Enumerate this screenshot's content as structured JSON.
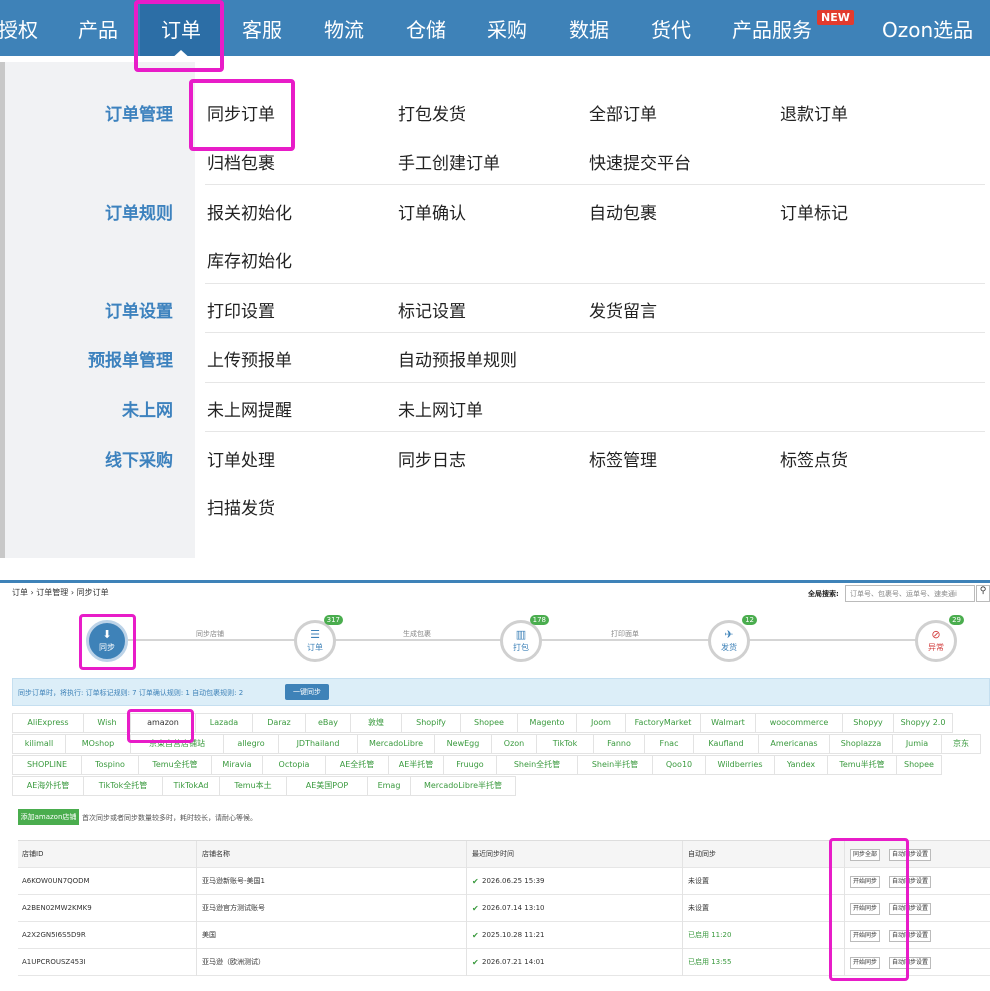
{
  "topnav": {
    "items": [
      "授权",
      "产品",
      "订单",
      "客服",
      "物流",
      "仓储",
      "采购",
      "数据",
      "货代",
      "产品服务",
      "Ozon选品"
    ],
    "new_badge": "NEW"
  },
  "menu": {
    "categories": {
      "order_mgmt": "订单管理",
      "order_rules": "订单规则",
      "order_settings": "订单设置",
      "prereport": "预报单管理",
      "offline": "未上网",
      "offline_purchase": "线下采购"
    },
    "order_mgmt": [
      "同步订单",
      "打包发货",
      "全部订单",
      "退款订单",
      "归档包裹",
      "手工创建订单",
      "快速提交平台"
    ],
    "order_rules": [
      "报关初始化",
      "订单确认",
      "自动包裹",
      "订单标记",
      "库存初始化"
    ],
    "order_settings": [
      "打印设置",
      "标记设置",
      "发货留言"
    ],
    "prereport": [
      "上传预报单",
      "自动预报单规则"
    ],
    "offline": [
      "未上网提醒",
      "未上网订单"
    ],
    "offline_purchase": [
      "订单处理",
      "同步日志",
      "标签管理",
      "标签点货",
      "扫描发货"
    ]
  },
  "bottom": {
    "breadcrumb": "订单 › 订单管理 › 同步订单",
    "global_search_label": "全局搜索:",
    "global_search_placeholder": "订单号、包裹号、运单号、速卖通i",
    "flow_labels": [
      "同步店铺",
      "生成包裹",
      "打印面单"
    ],
    "steps": [
      {
        "icon": "⬇",
        "label": "同步",
        "count": ""
      },
      {
        "icon": "☰",
        "label": "订单",
        "count": "317"
      },
      {
        "icon": "▥",
        "label": "打包",
        "count": "178"
      },
      {
        "icon": "✈",
        "label": "发货",
        "count": "12"
      },
      {
        "icon": "⊘",
        "label": "异常",
        "count": "29"
      }
    ],
    "info": "同步订单时，将执行: 订单标记规则: 7   订单确认规则: 1   自动包裹规则: 2",
    "one_click_sync": "一键同步",
    "platform_rows": [
      [
        "AliExpress",
        "Wish",
        "amazon",
        "Lazada",
        "Daraz",
        "eBay",
        "敦煌",
        "Shopify",
        "Shopee",
        "Magento",
        "Joom",
        "FactoryMarket",
        "Walmart",
        "woocommerce",
        "Shopyy",
        "Shopyy 2.0"
      ],
      [
        "kilimall",
        "MOshop",
        "京東自营店铺站",
        "allegro",
        "JDThailand",
        "MercadoLibre",
        "NewEgg",
        "Ozon",
        "TikTok",
        "Fanno",
        "Fnac",
        "Kaufland",
        "Americanas",
        "Shoplazza",
        "Jumia",
        "京东"
      ],
      [
        "SHOPLINE",
        "Tospino",
        "Temu全托管",
        "Miravia",
        "Octopia",
        "AE全托管",
        "AE半托管",
        "Fruugo",
        "Shein全托管",
        "Shein半托管",
        "Qoo10",
        "Wildberries",
        "Yandex",
        "Temu半托管",
        "Shopee"
      ],
      [
        "AE海外托管",
        "TikTok全托管",
        "TikTokAd",
        "Temu本土",
        "AE美国POP",
        "Emag",
        "MercadoLibre半托管"
      ]
    ],
    "add_store": "添加amazon店铺",
    "add_note": "首次同步或者同步数量较多时，耗时较长，请耐心等候。",
    "table": {
      "headers": [
        "店铺ID",
        "店铺名称",
        "最近同步时间",
        "自动同步"
      ],
      "sync_all": "同步全部",
      "auto_set": "自动同步设置",
      "start_sync": "开始同步",
      "rows": [
        {
          "id": "A6KOW0UN7QODM",
          "name": "亚马逊新账号-美国1",
          "time": "2026.06.25 15:39",
          "auto": "未设置"
        },
        {
          "id": "A2BEN02MW2KMK9",
          "name": "亚马逊官方测试账号",
          "time": "2026.07.14 13:10",
          "auto": "未设置"
        },
        {
          "id": "A2X2GN5I6S5D9R",
          "name": "美国",
          "time": "2025.10.28 11:21",
          "auto": "已启用 11:20"
        },
        {
          "id": "A1UPCROUSZ453I",
          "name": "亚马逊（欧洲测试）",
          "time": "2026.07.21 14:01",
          "auto": "已启用 13:55"
        }
      ]
    }
  },
  "colors": {
    "nav_bg": "#3e82b8",
    "highlight": "#e81cc8",
    "green": "#3a9a3e",
    "count_badge": "#4aad4e"
  }
}
